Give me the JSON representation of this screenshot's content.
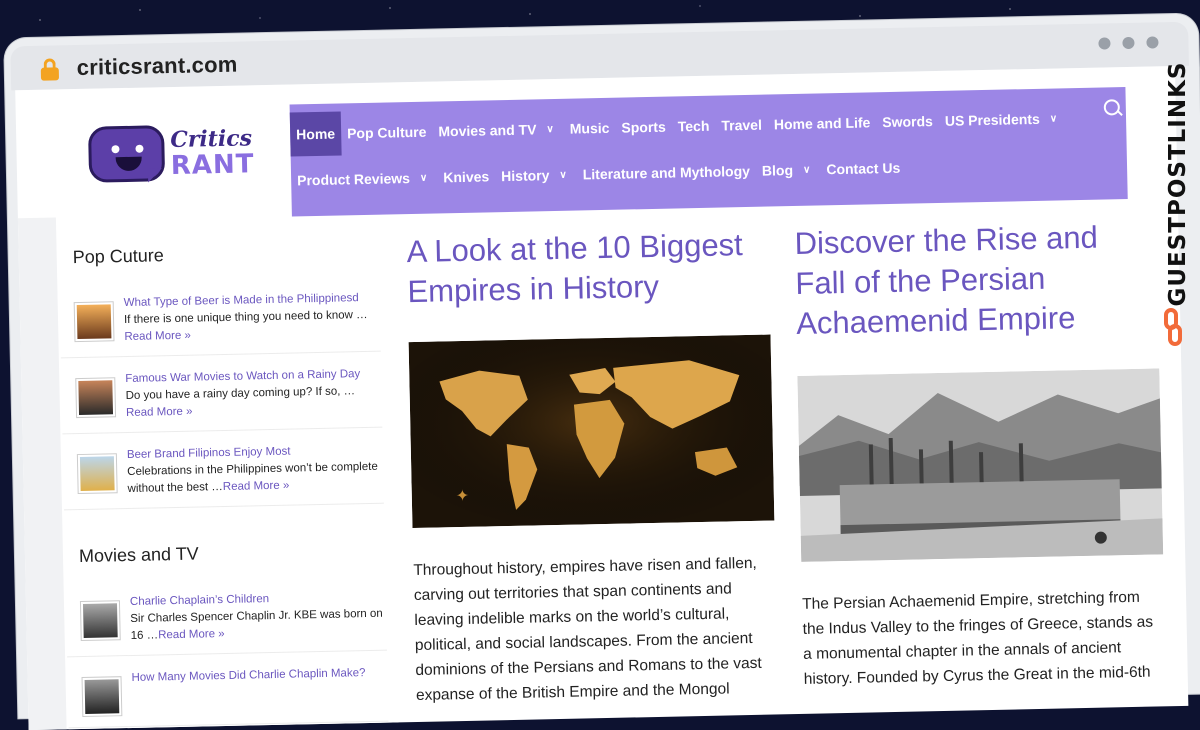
{
  "browser": {
    "url": "criticsrant.com"
  },
  "logo": {
    "line1": "Critics",
    "line2": "RANT"
  },
  "nav": {
    "row1": [
      "Home",
      "Pop Culture",
      "Movies and TV",
      "Music",
      "Sports",
      "Tech",
      "Travel",
      "Home and Life",
      "Swords",
      "US Presidents"
    ],
    "row2": [
      "Product Reviews",
      "Knives",
      "History",
      "Literature and Mythology",
      "Blog",
      "Contact Us"
    ]
  },
  "sidebar": {
    "section1": {
      "title": "Pop Cuture",
      "posts": [
        {
          "title": "What Type of Beer is Made in the Philippinesd",
          "excerpt": "If there is one unique thing you need to know …",
          "more": "Read More »"
        },
        {
          "title": "Famous War Movies to Watch on a Rainy Day",
          "excerpt": "Do you have a rainy day coming up? If so, …",
          "more": "Read More »"
        },
        {
          "title": "Beer Brand Filipinos Enjoy Most",
          "excerpt": "Celebrations in the Philippines won’t be complete without the best …",
          "more": "Read More »"
        }
      ]
    },
    "section2": {
      "title": "Movies and TV",
      "posts": [
        {
          "title": "Charlie Chaplain’s Children",
          "excerpt": "Sir Charles Spencer Chaplin Jr. KBE was born on 16 …",
          "more": "Read More »"
        },
        {
          "title": "How Many Movies Did Charlie Chaplin Make?",
          "excerpt": "",
          "more": ""
        }
      ]
    }
  },
  "articles": [
    {
      "title": "A Look at the 10 Biggest Empires in History",
      "excerpt": "Throughout history, empires have risen and fallen, carving out territories that span continents and leaving indelible marks on the world’s cultural, political, and social landscapes. From the ancient dominions of the Persians and Romans to the vast expanse of the British Empire and the Mongol"
    },
    {
      "title": "Discover the Rise and Fall of the Persian Achaemenid Empire",
      "excerpt": "The Persian Achaemenid Empire, stretching from the Indus Valley to the fringes of Greece, stands as a monumental chapter in the annals of ancient history. Founded by Cyrus the Great in the mid-6th"
    }
  ],
  "badge": {
    "text": "GUESTPOSTLINKS"
  },
  "colors": {
    "nav_bg": "#9c86e6",
    "nav_active": "#5b47a6",
    "link": "#6a56bf",
    "badge_accent": "#f26b3a"
  }
}
